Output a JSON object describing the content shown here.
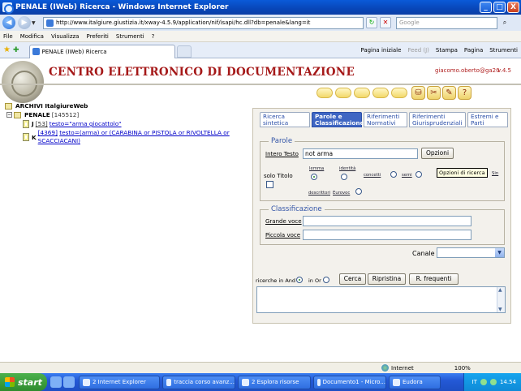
{
  "window": {
    "title": "PENALE (IWeb) Ricerca - Windows Internet Explorer",
    "controls": {
      "minimize": "_",
      "maximize": "□",
      "close": "X"
    }
  },
  "address_bar": {
    "url": "http://www.italgiure.giustizia.it/xway-4.5.9/application/nif/isapi/hc.dll?db=penale&lang=it",
    "search_placeholder": "Google"
  },
  "menu": [
    "File",
    "Modifica",
    "Visualizza",
    "Preferiti",
    "Strumenti",
    "?"
  ],
  "tab": {
    "label": "PENALE (IWeb) Ricerca"
  },
  "commands": [
    {
      "label": "Pagina iniziale",
      "dim": false
    },
    {
      "label": "Feed (J)",
      "dim": true
    },
    {
      "label": "Stampa",
      "dim": false
    },
    {
      "label": "Pagina",
      "dim": false
    },
    {
      "label": "Strumenti",
      "dim": false
    }
  ],
  "header": {
    "title": "CENTRO ELETTRONICO DI DOCUMENTAZIONE",
    "user": "giacomo.oberto@ga20",
    "version": "v.4.5"
  },
  "tree": {
    "root": "ARCHIVI ItalgiureWeb",
    "archive_name": "PENALE",
    "archive_count": "[145512]",
    "items": [
      {
        "letter": "J",
        "count": "[53]",
        "query": "testo=\"arma giocattolo\""
      },
      {
        "letter": "K",
        "count": "[4369]",
        "query": "testo=(arma) or (CARABINA or PISTOLA or RIVOLTELLA or SCACCIACANI)"
      }
    ]
  },
  "panel": {
    "tabs": [
      {
        "label": "Ricerca sintetica",
        "active": false
      },
      {
        "label": "Parole e Classificazione",
        "active": true
      },
      {
        "label": "Riferimenti Normativi",
        "active": false
      },
      {
        "label": "Riferimenti Giurisprudenziali",
        "active": false
      },
      {
        "label": "Estremi e Parti",
        "active": false
      }
    ],
    "parole": {
      "legend": "Parole",
      "intero_testo_label": "Intero Testo",
      "intero_testo_value": "not arma",
      "opzioni_label": "Opzioni",
      "solo_titolo_label": "solo Titolo",
      "options": {
        "lemma": "lemma",
        "identita": "identità",
        "concetti": "concetti",
        "semi": "semi",
        "descrittori": "descrittori",
        "eurovoc": "Eurovoc",
        "sin": "Sin"
      }
    },
    "tooltip": "Opzioni di ricerca",
    "classificazione": {
      "legend": "Classificazione",
      "grande_voce_label": "Grande voce",
      "piccola_voce_label": "Piccola voce"
    },
    "canale_label": "Canale",
    "ricerche_and_label": "ricerche in And",
    "in_or_label": "in Or",
    "buttons": {
      "cerca": "Cerca",
      "ripristina": "Ripristina",
      "frequenti": "R. frequenti"
    }
  },
  "status": {
    "zone": "Internet",
    "zoom": "100%"
  },
  "taskbar": {
    "start": "start",
    "tasks": [
      {
        "label": "2 Internet Explorer",
        "width": 100
      },
      {
        "label": "traccia corso avanz...",
        "width": 90
      },
      {
        "label": "2 Esplora risorse",
        "width": 90
      },
      {
        "label": "Documento1 - Micro...",
        "width": 90
      },
      {
        "label": "Eudora",
        "width": 78
      }
    ],
    "lang": "IT",
    "time": "14.54"
  }
}
